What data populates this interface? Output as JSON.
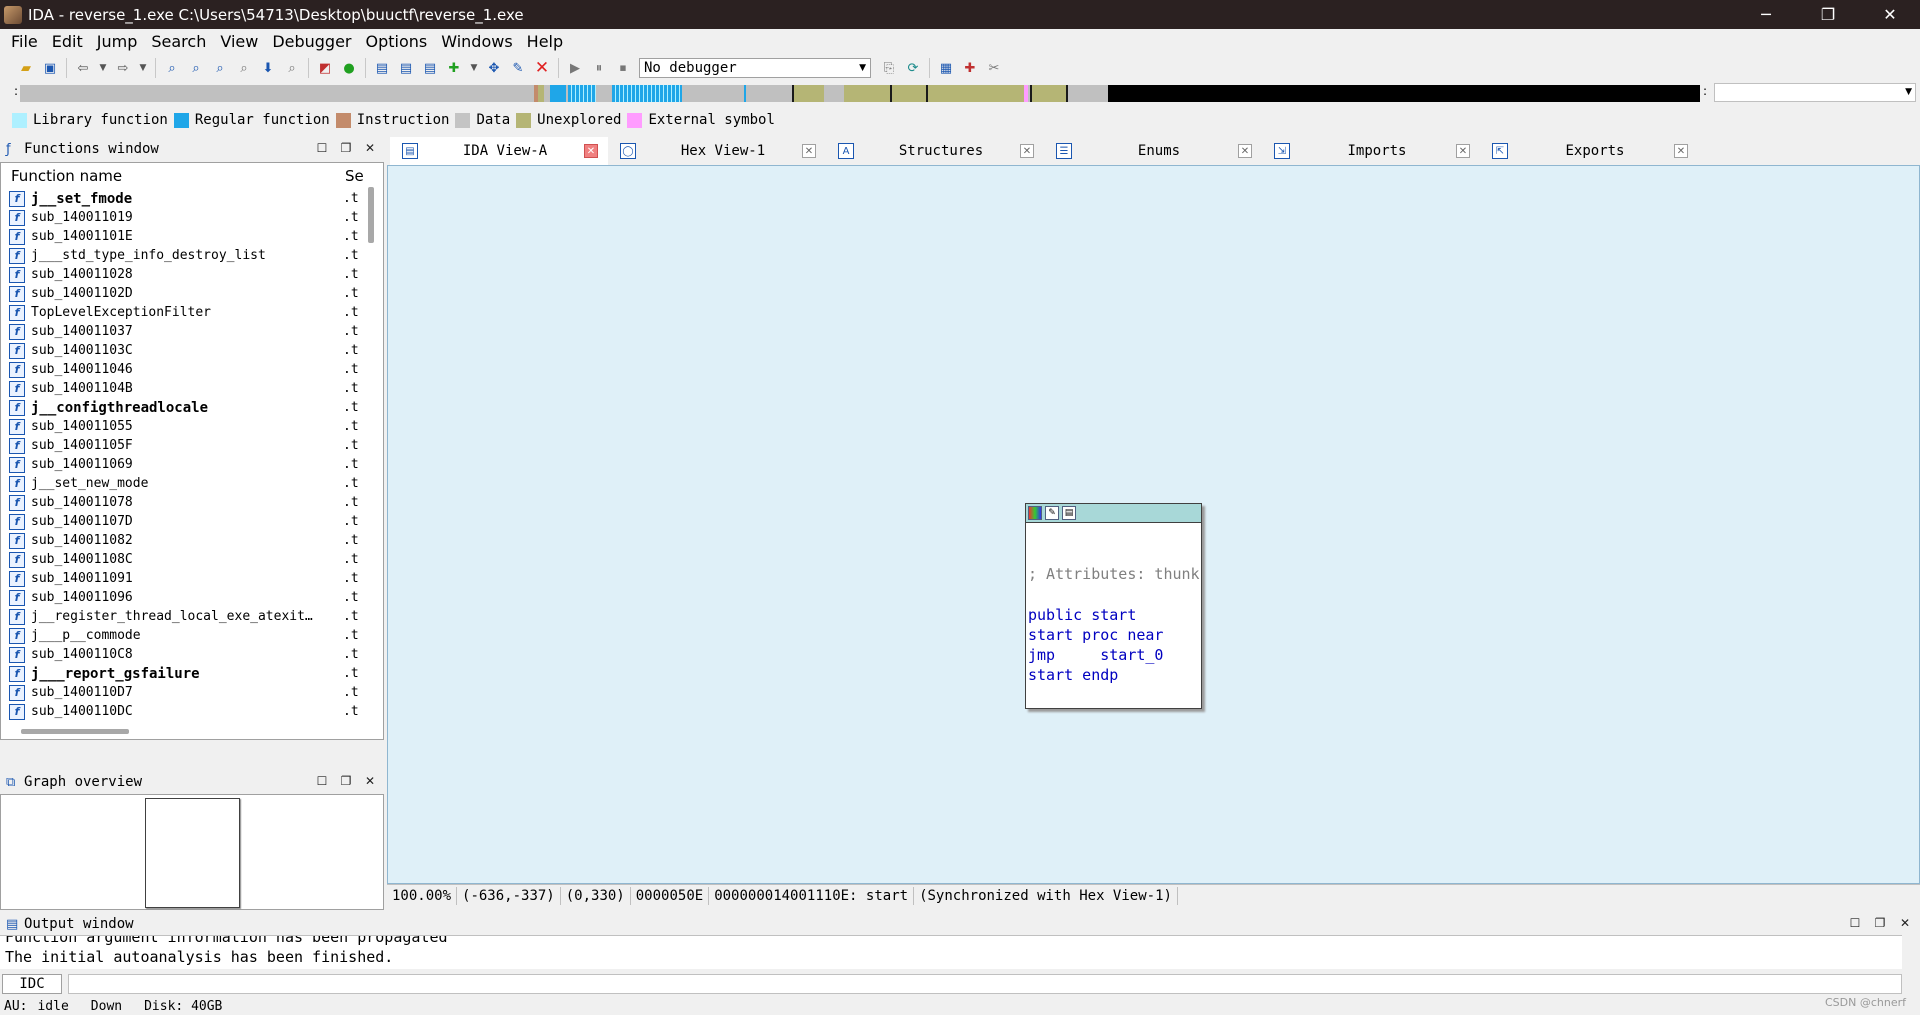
{
  "titlebar": {
    "title": "IDA - reverse_1.exe C:\\Users\\54713\\Desktop\\buuctf\\reverse_1.exe",
    "minimize": "─",
    "restore": "❐",
    "close": "✕"
  },
  "menu": [
    "File",
    "Edit",
    "Jump",
    "Search",
    "View",
    "Debugger",
    "Options",
    "Windows",
    "Help"
  ],
  "toolbar": {
    "debugger": "No debugger"
  },
  "legend": [
    {
      "label": "Library function",
      "color": "#aef0ff"
    },
    {
      "label": "Regular function",
      "color": "#1fa6e8"
    },
    {
      "label": "Instruction",
      "color": "#c38b6b"
    },
    {
      "label": "Data",
      "color": "#c4c4c4"
    },
    {
      "label": "Unexplored",
      "color": "#b5b575"
    },
    {
      "label": "External symbol",
      "color": "#ff9cff"
    }
  ],
  "functions_window": {
    "title": "Functions window",
    "col_name": "Function name",
    "col_segment": "Se",
    "rows": [
      {
        "name": "j__set_fmode",
        "seg": ".t",
        "bold": true
      },
      {
        "name": "sub_140011019",
        "seg": ".t",
        "bold": false
      },
      {
        "name": "sub_14001101E",
        "seg": ".t",
        "bold": false
      },
      {
        "name": "j___std_type_info_destroy_list",
        "seg": ".t",
        "bold": false
      },
      {
        "name": "sub_140011028",
        "seg": ".t",
        "bold": false
      },
      {
        "name": "sub_14001102D",
        "seg": ".t",
        "bold": false
      },
      {
        "name": "TopLevelExceptionFilter",
        "seg": ".t",
        "bold": false
      },
      {
        "name": "sub_140011037",
        "seg": ".t",
        "bold": false
      },
      {
        "name": "sub_14001103C",
        "seg": ".t",
        "bold": false
      },
      {
        "name": "sub_140011046",
        "seg": ".t",
        "bold": false
      },
      {
        "name": "sub_14001104B",
        "seg": ".t",
        "bold": false
      },
      {
        "name": "j__configthreadlocale",
        "seg": ".t",
        "bold": true
      },
      {
        "name": "sub_140011055",
        "seg": ".t",
        "bold": false
      },
      {
        "name": "sub_14001105F",
        "seg": ".t",
        "bold": false
      },
      {
        "name": "sub_140011069",
        "seg": ".t",
        "bold": false
      },
      {
        "name": "j__set_new_mode",
        "seg": ".t",
        "bold": false
      },
      {
        "name": "sub_140011078",
        "seg": ".t",
        "bold": false
      },
      {
        "name": "sub_14001107D",
        "seg": ".t",
        "bold": false
      },
      {
        "name": "sub_140011082",
        "seg": ".t",
        "bold": false
      },
      {
        "name": "sub_14001108C",
        "seg": ".t",
        "bold": false
      },
      {
        "name": "sub_140011091",
        "seg": ".t",
        "bold": false
      },
      {
        "name": "sub_140011096",
        "seg": ".t",
        "bold": false
      },
      {
        "name": "j__register_thread_local_exe_atexit…",
        "seg": ".t",
        "bold": false
      },
      {
        "name": "j___p__commode",
        "seg": ".t",
        "bold": false
      },
      {
        "name": "sub_1400110C8",
        "seg": ".t",
        "bold": false
      },
      {
        "name": "j___report_gsfailure",
        "seg": ".t",
        "bold": true
      },
      {
        "name": "sub_1400110D7",
        "seg": ".t",
        "bold": false
      },
      {
        "name": "sub_1400110DC",
        "seg": ".t",
        "bold": false
      }
    ]
  },
  "graph_overview": {
    "title": "Graph overview"
  },
  "tabs": [
    {
      "label": "IDA View-A",
      "icon": "ida-view-icon",
      "active": true
    },
    {
      "label": "Hex View-1",
      "icon": "hex-view-icon",
      "active": false
    },
    {
      "label": "Structures",
      "icon": "structures-icon",
      "active": false
    },
    {
      "label": "Enums",
      "icon": "enums-icon",
      "active": false
    },
    {
      "label": "Imports",
      "icon": "imports-icon",
      "active": false
    },
    {
      "label": "Exports",
      "icon": "exports-icon",
      "active": false
    }
  ],
  "graph_node": {
    "lines": [
      "; Attributes: thunk",
      "public start",
      "start proc near",
      "jmp     start_0",
      "start endp"
    ]
  },
  "status_line": [
    "100.00%",
    "(-636,-337)",
    "(0,330)",
    "0000050E",
    "000000014001110E: start",
    "(Synchronized with Hex View-1)"
  ],
  "output_window": {
    "title": "Output window",
    "lines": [
      "Function argument information has been propagated",
      "The initial autoanalysis has been finished."
    ]
  },
  "idc": {
    "label": "IDC"
  },
  "statusbar": {
    "au": "AU:",
    "state": "idle",
    "direction": "Down",
    "disk": "Disk: 40GB"
  },
  "watermark": "CSDN @chnerf"
}
